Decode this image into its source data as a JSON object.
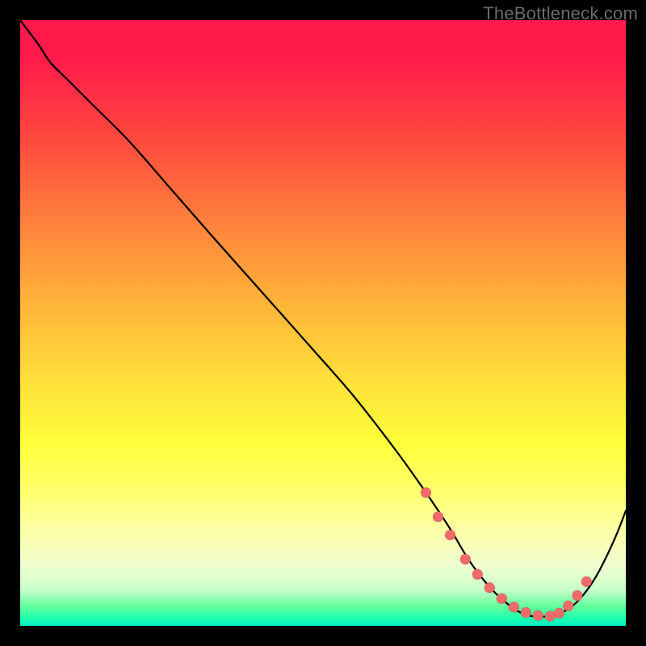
{
  "watermark": "TheBottleneck.com",
  "colors": {
    "page_bg": "#000000",
    "curve_stroke": "#000000",
    "dot_fill": "#f06a6a",
    "gradient_stops": [
      "#ff1a4b",
      "#ff4a3e",
      "#ff843c",
      "#ffb83a",
      "#ffe13a",
      "#ffff3c",
      "#ffff6e",
      "#fdffa6",
      "#f1ffd0",
      "#c9ffcb",
      "#5cff9a",
      "#17ffb6",
      "#00f0c8"
    ]
  },
  "chart_data": {
    "type": "line",
    "title": "",
    "xlabel": "",
    "ylabel": "",
    "xlim": [
      0,
      100
    ],
    "ylim": [
      0,
      100
    ],
    "series": [
      {
        "name": "curve",
        "x": [
          0,
          3,
          5,
          8,
          12,
          18,
          25,
          32,
          40,
          48,
          55,
          62,
          67,
          71,
          74,
          77,
          80,
          83,
          86,
          89,
          92,
          95,
          98,
          100
        ],
        "y": [
          100,
          96,
          93,
          90,
          86,
          80,
          72,
          64,
          55,
          46,
          38,
          29,
          22,
          16,
          11,
          7,
          4,
          2,
          1.5,
          2,
          4,
          8,
          14,
          19
        ]
      }
    ],
    "markers": {
      "name": "highlight-dots",
      "x": [
        67,
        69,
        71,
        73.5,
        75.5,
        77.5,
        79.5,
        81.5,
        83.5,
        85.5,
        87.5,
        89,
        90.5,
        92,
        93.5
      ],
      "y": [
        22,
        18,
        15,
        11,
        8.5,
        6.3,
        4.5,
        3.1,
        2.2,
        1.7,
        1.6,
        2.1,
        3.3,
        5.0,
        7.3
      ]
    }
  }
}
